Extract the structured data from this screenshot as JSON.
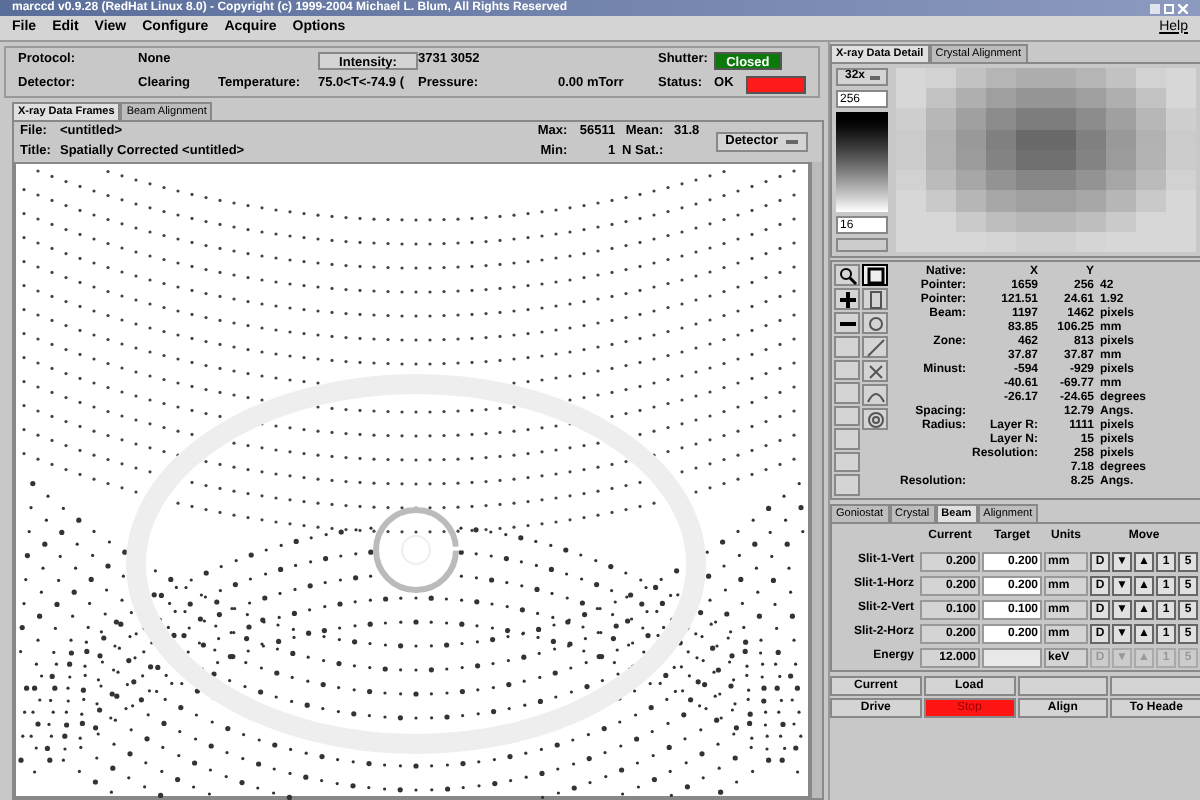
{
  "window": {
    "title": "marccd v0.9.28 (RedHat Linux 8.0) - Copyright (c) 1999-2004 Michael L. Blum, All Rights Reserved"
  },
  "menu": [
    "File",
    "Edit",
    "View",
    "Configure",
    "Acquire",
    "Options"
  ],
  "help_menu": "Help",
  "status": {
    "protocol_label": "Protocol:",
    "protocol": "None",
    "intensity_button": "Intensity:",
    "intensity": "3731  3052",
    "shutter_label": "Shutter:",
    "shutter": "Closed",
    "detector_label": "Detector:",
    "detector": "Clearing",
    "temperature_label": "Temperature:",
    "temperature": "75.0<T<-74.9 (",
    "pressure_label": "Pressure:",
    "pressure": "0.00 mTorr",
    "status_label": "Status:",
    "status": "OK"
  },
  "left_tabs": [
    {
      "label": "X-ray Data Frames",
      "selected": true
    },
    {
      "label": "Beam Alignment",
      "selected": false
    }
  ],
  "frame_info": {
    "file_label": "File:",
    "file": "<untitled>",
    "title_label": "Title:",
    "title": "Spatially Corrected <untitled>",
    "max_label": "Max:",
    "max": "56511",
    "mean_label": "Mean:",
    "mean": "31.8",
    "min_label": "Min:",
    "min": "1",
    "nsat_label": "N Sat.:",
    "detector_button": "Detector"
  },
  "right_tabs": [
    {
      "label": "X-ray Data Detail",
      "selected": true
    },
    {
      "label": "Crystal Alignment",
      "selected": false
    }
  ],
  "zoom_menu": "32x",
  "scale_max": "256",
  "scale_min": "16",
  "info_rows": [
    {
      "label": "Native:",
      "col_1": "X",
      "col_2": "Y"
    },
    {
      "label": "Pointer:",
      "col_1": "1659",
      "col_2": "256",
      "col_3": "42"
    },
    {
      "label": "Pointer:",
      "col_1": "121.51",
      "col_2": "24.61",
      "col_3": "1.92"
    },
    {
      "label": "Beam:",
      "col_1": "1197",
      "col_2": "1462",
      "col_3": "pixels"
    },
    {
      "col_1": "83.85",
      "col_2": "106.25",
      "col_3": "mm"
    },
    {
      "label": "Zone:",
      "col_1": "462",
      "col_2": "813",
      "col_3": "pixels"
    },
    {
      "col_1": "37.87",
      "col_2": "37.87",
      "col_3": "mm"
    },
    {
      "label": "Minust:",
      "col_1": "-594",
      "col_2": "-929",
      "col_3": "pixels"
    },
    {
      "col_1": "-40.61",
      "col_2": "-69.77",
      "col_3": "mm"
    },
    {
      "col_1": "-26.17",
      "col_2": "-24.65",
      "col_3": "degrees"
    },
    {
      "label": "Spacing:",
      "col_2": "12.79",
      "col_3": "Angs."
    },
    {
      "label": "Radius:",
      "col_1": "Layer R:",
      "col_2": "1111",
      "col_3": "pixels"
    },
    {
      "col_1": "Layer N:",
      "col_2": "15",
      "col_3": "pixels"
    },
    {
      "col_1": "Resolution:",
      "col_2": "258",
      "col_3": "pixels"
    },
    {
      "col_2": "7.18",
      "col_3": "degrees"
    },
    {
      "label": "Resolution:",
      "col_2": "8.25",
      "col_3": "Angs."
    }
  ],
  "lower_tabs": [
    {
      "label": "Goniostat",
      "selected": false
    },
    {
      "label": "Crystal",
      "selected": false
    },
    {
      "label": "Beam",
      "selected": true
    },
    {
      "label": "Alignment",
      "selected": false
    }
  ],
  "beam_table": {
    "columns": [
      "Current",
      "Target",
      "Units",
      "Move"
    ],
    "rows": [
      {
        "name": "Slit-1-Vert",
        "current": "0.200",
        "target": "0.200",
        "units": "mm",
        "disabled": false,
        "move": [
          "D",
          "▼",
          "▲",
          "1",
          "5"
        ]
      },
      {
        "name": "Slit-1-Horz",
        "current": "0.200",
        "target": "0.200",
        "units": "mm",
        "disabled": false,
        "move": [
          "D",
          "▼",
          "▲",
          "1",
          "5"
        ]
      },
      {
        "name": "Slit-2-Vert",
        "current": "0.100",
        "target": "0.100",
        "units": "mm",
        "disabled": false,
        "move": [
          "D",
          "▼",
          "▲",
          "1",
          "5"
        ]
      },
      {
        "name": "Slit-2-Horz",
        "current": "0.200",
        "target": "0.200",
        "units": "mm",
        "disabled": false,
        "move": [
          "D",
          "▼",
          "▲",
          "1",
          "5"
        ]
      },
      {
        "name": "Energy",
        "current": "12.000",
        "units": "keV",
        "disabled": true,
        "move": [
          "D",
          "▼",
          "▲",
          "1",
          "5"
        ]
      }
    ]
  },
  "bottom_buttons": [
    {
      "kind": "button",
      "label": "Current"
    },
    {
      "kind": "button",
      "label": "Load"
    },
    {
      "kind": "blank"
    },
    {
      "kind": "blank"
    },
    {
      "kind": "button",
      "label": "Drive"
    },
    {
      "kind": "stop",
      "label": "Stop"
    },
    {
      "kind": "button",
      "label": "Align"
    },
    {
      "kind": "button",
      "label": "To Heade"
    }
  ]
}
